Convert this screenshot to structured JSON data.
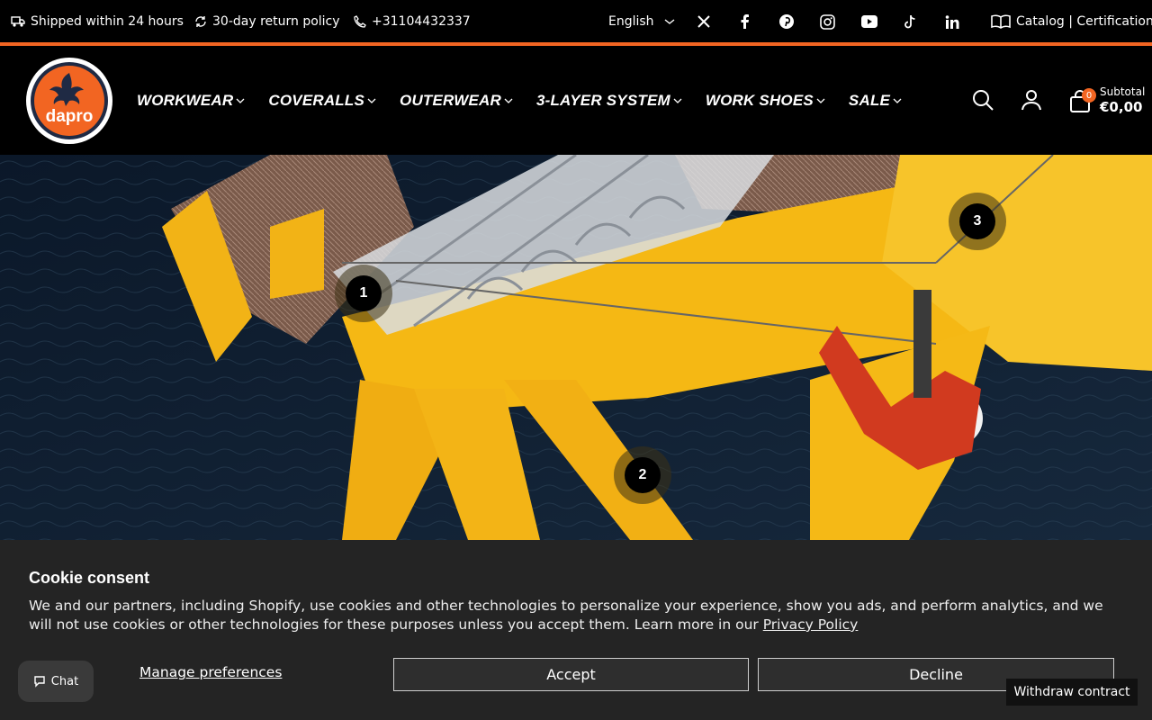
{
  "topbar": {
    "shipping": "Shipped within 24 hours",
    "returns": "30-day return policy",
    "phone": "+31104432337",
    "language": "English",
    "social_icons": [
      "x-icon",
      "facebook-icon",
      "pinterest-icon",
      "instagram-icon",
      "youtube-icon",
      "tiktok-icon",
      "linkedin-icon"
    ],
    "catalog": "Catalog | Certification"
  },
  "header": {
    "logo_text": "dapro",
    "nav": [
      "WORKWEAR",
      "COVERALLS",
      "OUTERWEAR",
      "3-LAYER SYSTEM",
      "WORK SHOES",
      "SALE"
    ],
    "cart_count": "0",
    "subtotal_label": "Subtotal",
    "subtotal_value": "€0,00"
  },
  "hero": {
    "hotspots": [
      "1",
      "2",
      "3"
    ]
  },
  "cookie": {
    "title": "Cookie consent",
    "text": "We and our partners, including Shopify, use cookies and other technologies to personalize your experience, show you ads, and perform analytics, and we will not use cookies or other technologies for these purposes unless you accept them. Learn more in our ",
    "privacy_link": "Privacy Policy",
    "manage": "Manage preferences",
    "accept": "Accept",
    "decline": "Decline"
  },
  "chat": {
    "label": "Chat"
  },
  "withdraw": {
    "label": "Withdraw contract"
  },
  "colors": {
    "accent": "#f26522",
    "hero_yellow": "#f5b814",
    "sea": "#0e1a2a"
  }
}
